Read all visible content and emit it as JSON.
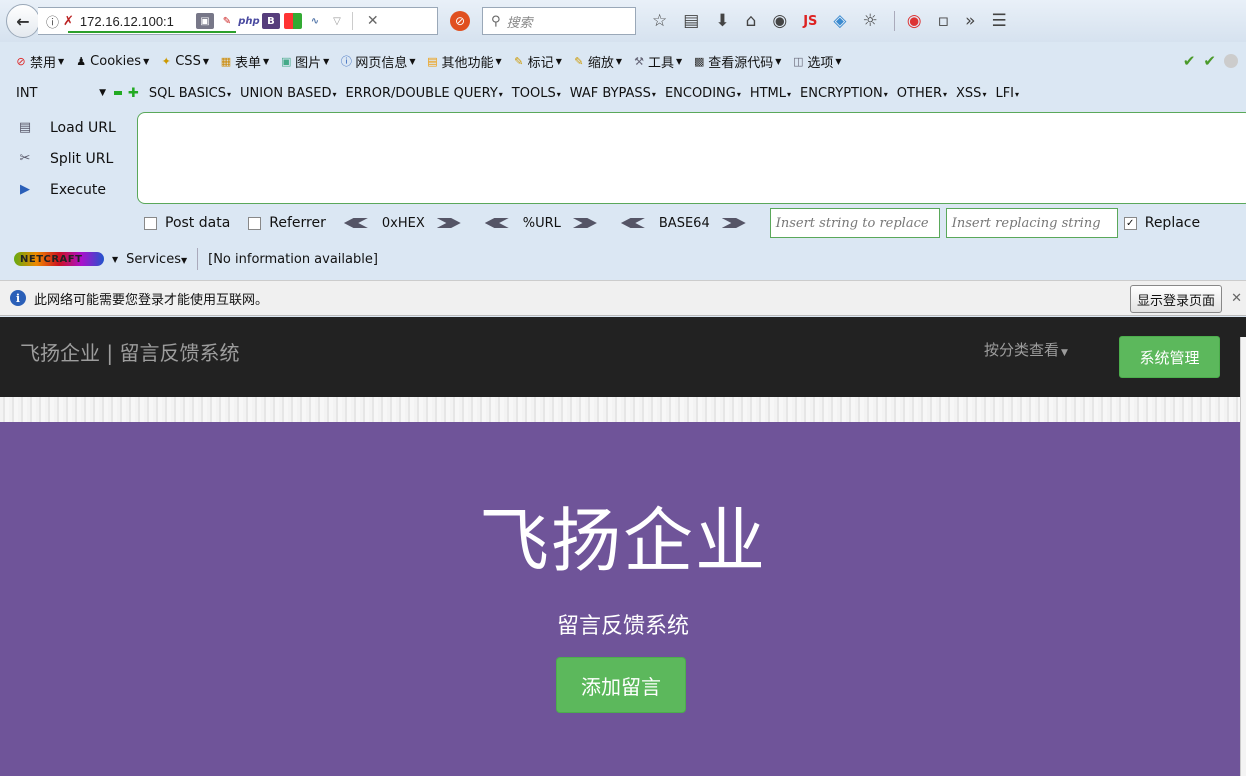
{
  "browser": {
    "url": "172.16.12.100:1",
    "search_placeholder": "搜索"
  },
  "devbar": {
    "items": [
      "禁用",
      "Cookies",
      "CSS",
      "表单",
      "图片",
      "网页信息",
      "其他功能",
      "标记",
      "缩放",
      "工具",
      "查看源代码",
      "选项"
    ]
  },
  "hackbar": {
    "select_value": "INT",
    "menus": [
      "SQL BASICS",
      "UNION BASED",
      "ERROR/DOUBLE QUERY",
      "TOOLS",
      "WAF BYPASS",
      "ENCODING",
      "HTML",
      "ENCRYPTION",
      "OTHER",
      "XSS",
      "LFI"
    ],
    "load_url": "Load URL",
    "split_url": "Split URL",
    "execute": "Execute",
    "post_data": "Post data",
    "referrer": "Referrer",
    "hex": "0xHEX",
    "url_enc": "%URL",
    "base64": "BASE64",
    "replace_placeholder": "Insert string to replace",
    "replacing_placeholder": "Insert replacing string",
    "replace_label": "Replace"
  },
  "netcraft": {
    "logo": "NETCRAFT",
    "services": "Services",
    "info": "[No information available]"
  },
  "infobar": {
    "message": "此网络可能需要您登录才能使用互联网。",
    "button": "显示登录页面"
  },
  "site": {
    "brand": "飞扬企业 | 留言反馈系统",
    "nav_link": "按分类查看",
    "admin_button": "系统管理",
    "hero_title": "飞扬企业",
    "hero_subtitle": "留言反馈系统",
    "hero_button": "添加留言"
  },
  "colors": {
    "navbar_bg": "#222222",
    "hero_bg": "#6f5499",
    "success_green": "#5cb85c"
  }
}
